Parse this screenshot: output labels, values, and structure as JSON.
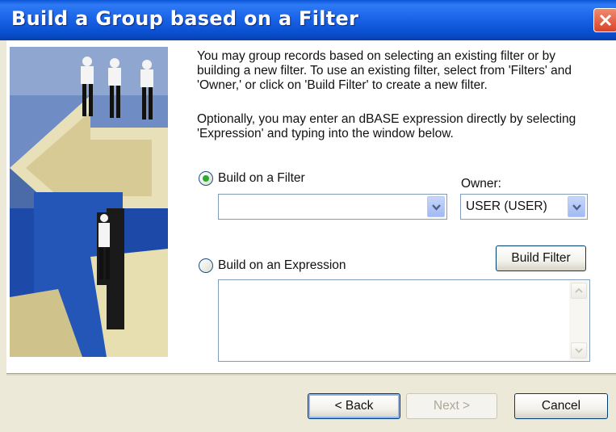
{
  "window": {
    "title": "Build a Group based on a Filter"
  },
  "description": {
    "paragraph1": "You may group records based on selecting an existing filter or by building a new filter.  To use an existing filter, select from 'Filters' and 'Owner,' or click on 'Build Filter' to create a new filter.",
    "paragraph2": "Optionally, you may enter an dBASE expression directly by selecting 'Expression' and typing into the window below."
  },
  "filter_option": {
    "label": "Build on a Filter",
    "selected": true,
    "filter_value": ""
  },
  "owner": {
    "label": "Owner:",
    "value": "USER (USER)"
  },
  "expression_option": {
    "label": "Build on an Expression",
    "selected": false,
    "expression_value": ""
  },
  "buttons": {
    "build_filter": "Build Filter",
    "back": "< Back",
    "next": "Next >",
    "cancel": "Cancel"
  },
  "colors": {
    "titlebar": "#0a50d0",
    "radio_selected": "#2bab2b",
    "close_button": "#d8442a"
  }
}
